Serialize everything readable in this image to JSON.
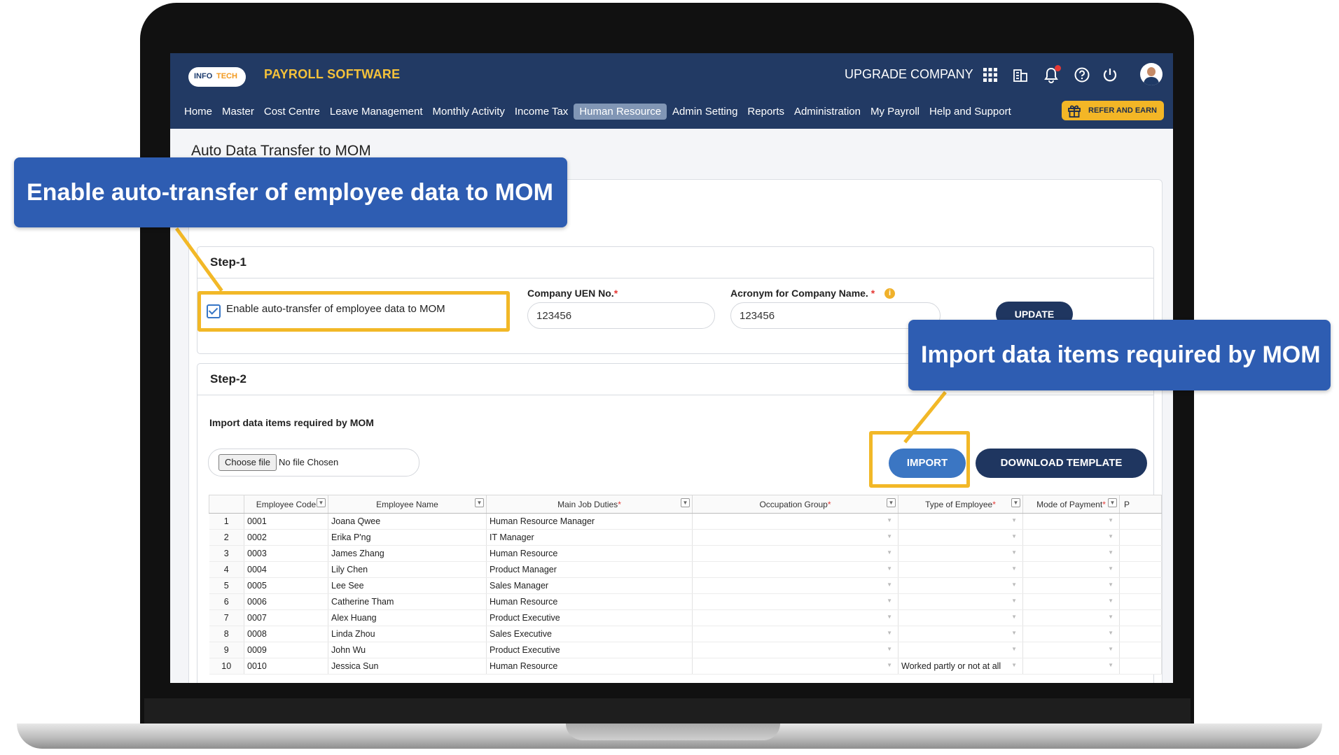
{
  "header": {
    "logo_left": "INFO",
    "logo_right": "TECH",
    "brand": "PAYROLL SOFTWARE",
    "upgrade": "UPGRADE COMPANY"
  },
  "nav": {
    "items": [
      "Home",
      "Master",
      "Cost Centre",
      "Leave Management",
      "Monthly Activity",
      "Income Tax",
      "Human Resource",
      "Admin Setting",
      "Reports",
      "Administration",
      "My Payroll",
      "Help and Support"
    ],
    "active": "Human Resource",
    "refer": "REFER AND EARN"
  },
  "page": {
    "title": "Auto Data Transfer to MOM"
  },
  "step1": {
    "title": "Step-1",
    "checkbox_label": "Enable auto-transfer of employee data to MOM",
    "uen_label": "Company UEN No.",
    "uen_value": "123456",
    "acronym_label": "Acronym for Company Name. ",
    "acronym_value": "123456",
    "update": "UPDATE",
    "req_mark": "*"
  },
  "step2": {
    "title": "Step-2",
    "subtitle": "Import data items required by MOM",
    "choose_file": "Choose file",
    "no_file": "No file Chosen",
    "import": "IMPORT",
    "download": "DOWNLOAD TEMPLATE"
  },
  "table": {
    "headers": {
      "code": "Employee Code",
      "name": "Employee Name",
      "duties": "Main Job Duties",
      "occ": "Occupation Group",
      "type": "Type of Employee",
      "mode": "Mode of Payment",
      "extra": "P"
    },
    "rows": [
      {
        "n": "1",
        "code": "0001",
        "name": "Joana Qwee",
        "duties": "Human Resource Manager",
        "type": ""
      },
      {
        "n": "2",
        "code": "0002",
        "name": "Erika P'ng",
        "duties": "IT Manager",
        "type": ""
      },
      {
        "n": "3",
        "code": "0003",
        "name": "James Zhang",
        "duties": "Human Resource",
        "type": ""
      },
      {
        "n": "4",
        "code": "0004",
        "name": "Lily Chen",
        "duties": "Product Manager",
        "type": ""
      },
      {
        "n": "5",
        "code": "0005",
        "name": "Lee See",
        "duties": "Sales Manager",
        "type": ""
      },
      {
        "n": "6",
        "code": "0006",
        "name": "Catherine Tham",
        "duties": "Human Resource",
        "type": ""
      },
      {
        "n": "7",
        "code": "0007",
        "name": "Alex Huang",
        "duties": "Product Executive",
        "type": ""
      },
      {
        "n": "8",
        "code": "0008",
        "name": "Linda Zhou",
        "duties": "Sales Executive",
        "type": ""
      },
      {
        "n": "9",
        "code": "0009",
        "name": "John Wu",
        "duties": "Product Executive",
        "type": ""
      },
      {
        "n": "10",
        "code": "0010",
        "name": "Jessica Sun",
        "duties": "Human Resource",
        "type": "Worked partly or not at all"
      }
    ]
  },
  "callouts": {
    "enable": "Enable auto-transfer of employee data to MOM",
    "import": "Import data items required by MOM"
  },
  "colors": {
    "navy": "#223a64",
    "accent": "#f2b827",
    "callout": "#2e5db2",
    "brand": "#f5c23a"
  },
  "icons": [
    "apps-grid-icon",
    "building-icon",
    "bell-icon",
    "help-icon",
    "power-icon",
    "user-avatar",
    "gift-icon",
    "filter-icon",
    "checkbox-icon",
    "info-icon"
  ]
}
